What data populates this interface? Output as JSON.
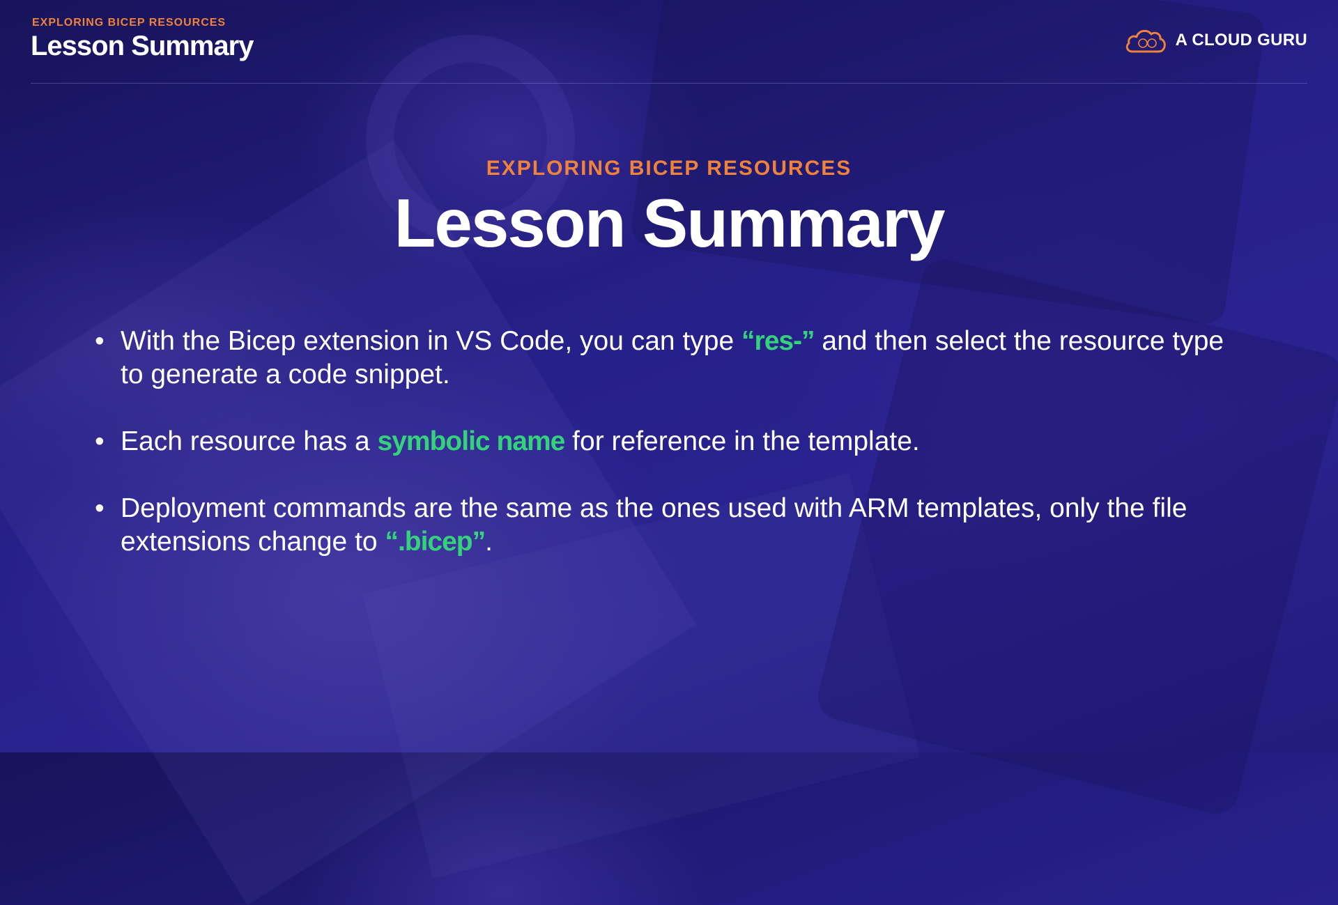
{
  "header": {
    "eyebrow": "EXPLORING BICEP RESOURCES",
    "title": "Lesson Summary"
  },
  "brand": {
    "icon": "cloud-icon",
    "name": "A CLOUD GURU"
  },
  "hero": {
    "eyebrow": "EXPLORING BICEP RESOURCES",
    "title": "Lesson Summary"
  },
  "bullets": [
    {
      "marker": "•",
      "pre": "With the Bicep extension in VS Code, you can type ",
      "highlight": "“res-”",
      "post": " and then select the resource type to generate a code snippet."
    },
    {
      "marker": "•",
      "pre": "Each resource has a ",
      "highlight": "symbolic name",
      "post": " for reference in the template."
    },
    {
      "marker": "•",
      "pre": "Deployment commands are the same as the ones used with ARM templates, only the file extensions change to ",
      "highlight": "“.bicep”",
      "post": "."
    }
  ],
  "colors": {
    "accent_orange": "#f0823a",
    "highlight_green": "#34d27a",
    "background": "#26208a"
  }
}
